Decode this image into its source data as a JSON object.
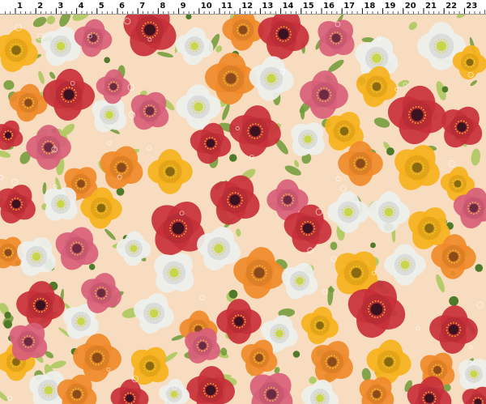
{
  "ruler": {
    "labels": [
      "1",
      "2",
      "3",
      "4",
      "5",
      "6",
      "7",
      "8",
      "9",
      "10",
      "11",
      "12",
      "13",
      "14",
      "15",
      "16",
      "17",
      "18",
      "19",
      "20",
      "21",
      "22",
      "23"
    ]
  },
  "fabric": {
    "background": "#f7dcc0",
    "palette": {
      "red": "#c8303a",
      "pink": "#d8607a",
      "orange": "#f08a2a",
      "yellow": "#f6b21c",
      "white": "#eef0ee",
      "leaf": "#6f9a35",
      "leaf_light": "#a9c85a"
    }
  }
}
